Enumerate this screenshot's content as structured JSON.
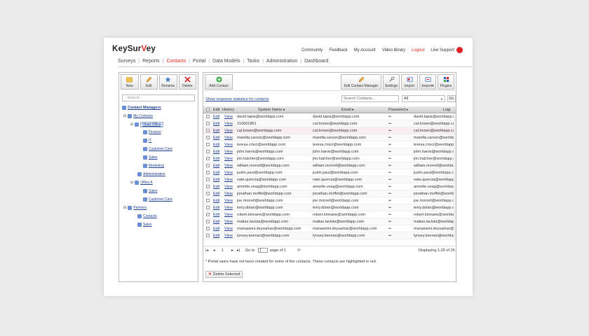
{
  "brand": {
    "prefix": "KeySur",
    "v": "V",
    "suffix": "ey"
  },
  "toplinks": [
    "Community",
    "Feedback",
    "My Account",
    "Video library",
    "Logout",
    "Live Support"
  ],
  "nav": [
    "Surveys",
    "Reports",
    "Contacts",
    "Portal",
    "Data Models",
    "Tasks",
    "Administration",
    "Dashboard"
  ],
  "left_toolbar": [
    "New",
    "Edit",
    "Rename",
    "Delete"
  ],
  "search_placeholder": "- Search -",
  "tree": {
    "root": "Contact Managers",
    "my_contacts": "My Contacts",
    "head_office": "Head Office",
    "finance": "Finance",
    "it": "IT",
    "customer_care": "Customer Care",
    "sales": "Sales",
    "marketing": "Marketing",
    "administration": "Administration",
    "office_a": "Office A",
    "office_a_sales": "Sales",
    "office_a_customer_care": "Customer Care",
    "partners": "Partners",
    "partners_contacts": "Contacts",
    "partners_sales": "Sales"
  },
  "add_contact": "Add Contact",
  "right_toolbar": [
    "Edit Contact Manager",
    "Settings",
    "Import",
    "Export",
    "Plugins"
  ],
  "stats_link": "Show response statistics for contacts",
  "search_contacts": "Search Contacts...",
  "filter_value": "All",
  "go": "Go",
  "columns": [
    "Edit",
    "History",
    "System Name",
    "Email",
    "Password",
    "Logi"
  ],
  "edit_label": "Edit",
  "view_label": "View",
  "password_mask": "••",
  "rows": [
    [
      "david.tapia@worldapp.com",
      "david.tapia@worldapp.com",
      "david.tapia@worldapp.com"
    ],
    [
      "216061861",
      "cal.brown@worldapp.com",
      "cal.brown@worldapp.com"
    ],
    [
      "cal.brown@worldapp.com",
      "cal.brown@worldapp.com",
      "cal.brown@worldapp.com"
    ],
    [
      "marella.carson@worldapp.com",
      "marella.carson@worldapp.com",
      "marella.carson@worldapp.com"
    ],
    [
      "teresa.crisci@worldapp.com",
      "teresa.crisci@worldapp.com",
      "teresa.crisci@worldapp.com"
    ],
    [
      "john.harris@worldapp.com",
      "john.harris@worldapp.com",
      "john.harris@worldapp.com"
    ],
    [
      "jim.hatcher@worldapp.com",
      "jim.hatcher@worldapp.com",
      "jim.hatcher@worldapp.com"
    ],
    [
      "william.morrell@worldapp.com",
      "william.morrell@worldapp.com",
      "william.morrell@worldapp.com"
    ],
    [
      "justin.paul@worldapp.com",
      "justin.paul@worldapp.com",
      "justin.paul@worldapp.com"
    ],
    [
      "nate.quercia@worldapp.com",
      "nate.quercia@worldapp.com",
      "nate.quercia@worldapp.com"
    ],
    [
      "annette.veag@worldapp.com",
      "annette.veag@worldapp.com",
      "annette.veag@worldapp.com"
    ],
    [
      "jonathan.moffet@worldapp.com",
      "jonathan.moffet@worldapp.com",
      "jonathan.moffet@worldapp.com"
    ],
    [
      "joe.morrell@worldapp.com",
      "joe.morrell@worldapp.com",
      "joe.morrell@worldapp.com"
    ],
    [
      "terry.dolan@worldapp.com",
      "terry.dolan@worldapp.com",
      "terry.dolan@worldapp.com"
    ],
    [
      "robert.kinnane@worldapp.com",
      "robert.kinnane@worldapp.com",
      "robert.kinnane@worldapp.com"
    ],
    [
      "matias.lavista@worldapp.com",
      "matias.lavista@worldapp.com",
      "matias.lavista@worldapp.com"
    ],
    [
      "manaswini.deysarkar@worldapp.com",
      "manaswini.deysarkar@worldapp.com",
      "manaswini.deysarkar@worldapp.com"
    ],
    [
      "lynsey.keenan@worldapp.com",
      "lynsey.keenan@worldapp.com",
      "lynsey.keenan@worldapp.com"
    ]
  ],
  "pager": {
    "current": "1",
    "go_to": "Go to",
    "page_of": "page of 1",
    "input": "1",
    "displaying": "Displaying 1-26 of 26"
  },
  "note": "* Portal users have not been created for some of the contacts. These contacts are highlighted in red.",
  "delete_selected": "Delete Selected",
  "colors": {
    "accent": "#e2231a",
    "link": "#1d3f8c"
  }
}
